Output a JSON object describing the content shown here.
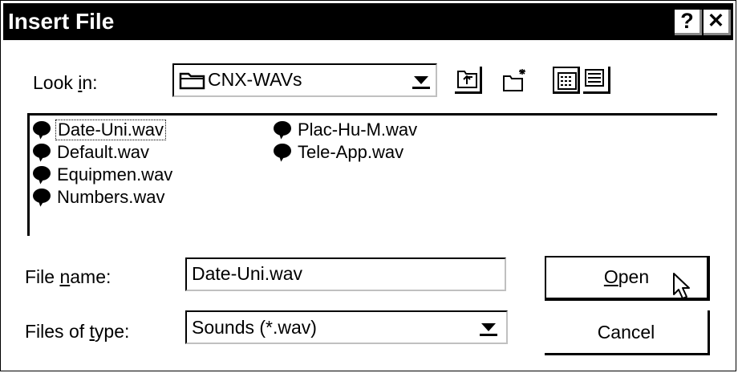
{
  "window": {
    "title": "Insert File",
    "help_button": "?",
    "close_button": "✕"
  },
  "lookin": {
    "label_pre": "Look ",
    "label_accel": "i",
    "label_post": "n:",
    "value": "CNX-WAVs"
  },
  "toolbar": {
    "icons": [
      "up-one-level-icon",
      "create-new-folder-icon",
      "list-view-icon",
      "details-view-icon"
    ]
  },
  "files": {
    "items": [
      {
        "name": "Date-Uni.wav",
        "selected": true
      },
      {
        "name": "Default.wav"
      },
      {
        "name": "Equipmen.wav"
      },
      {
        "name": "Numbers.wav"
      },
      {
        "name": "Plac-Hu-M.wav"
      },
      {
        "name": "Tele-App.wav"
      }
    ]
  },
  "filename": {
    "label_pre": "File ",
    "label_accel": "n",
    "label_post": "ame:",
    "value": "Date-Uni.wav"
  },
  "filetype": {
    "label_pre": "Files of ",
    "label_accel": "t",
    "label_post": "ype:",
    "value": "Sounds (*.wav)"
  },
  "buttons": {
    "open_accel": "O",
    "open_rest": "pen",
    "cancel": "Cancel"
  }
}
